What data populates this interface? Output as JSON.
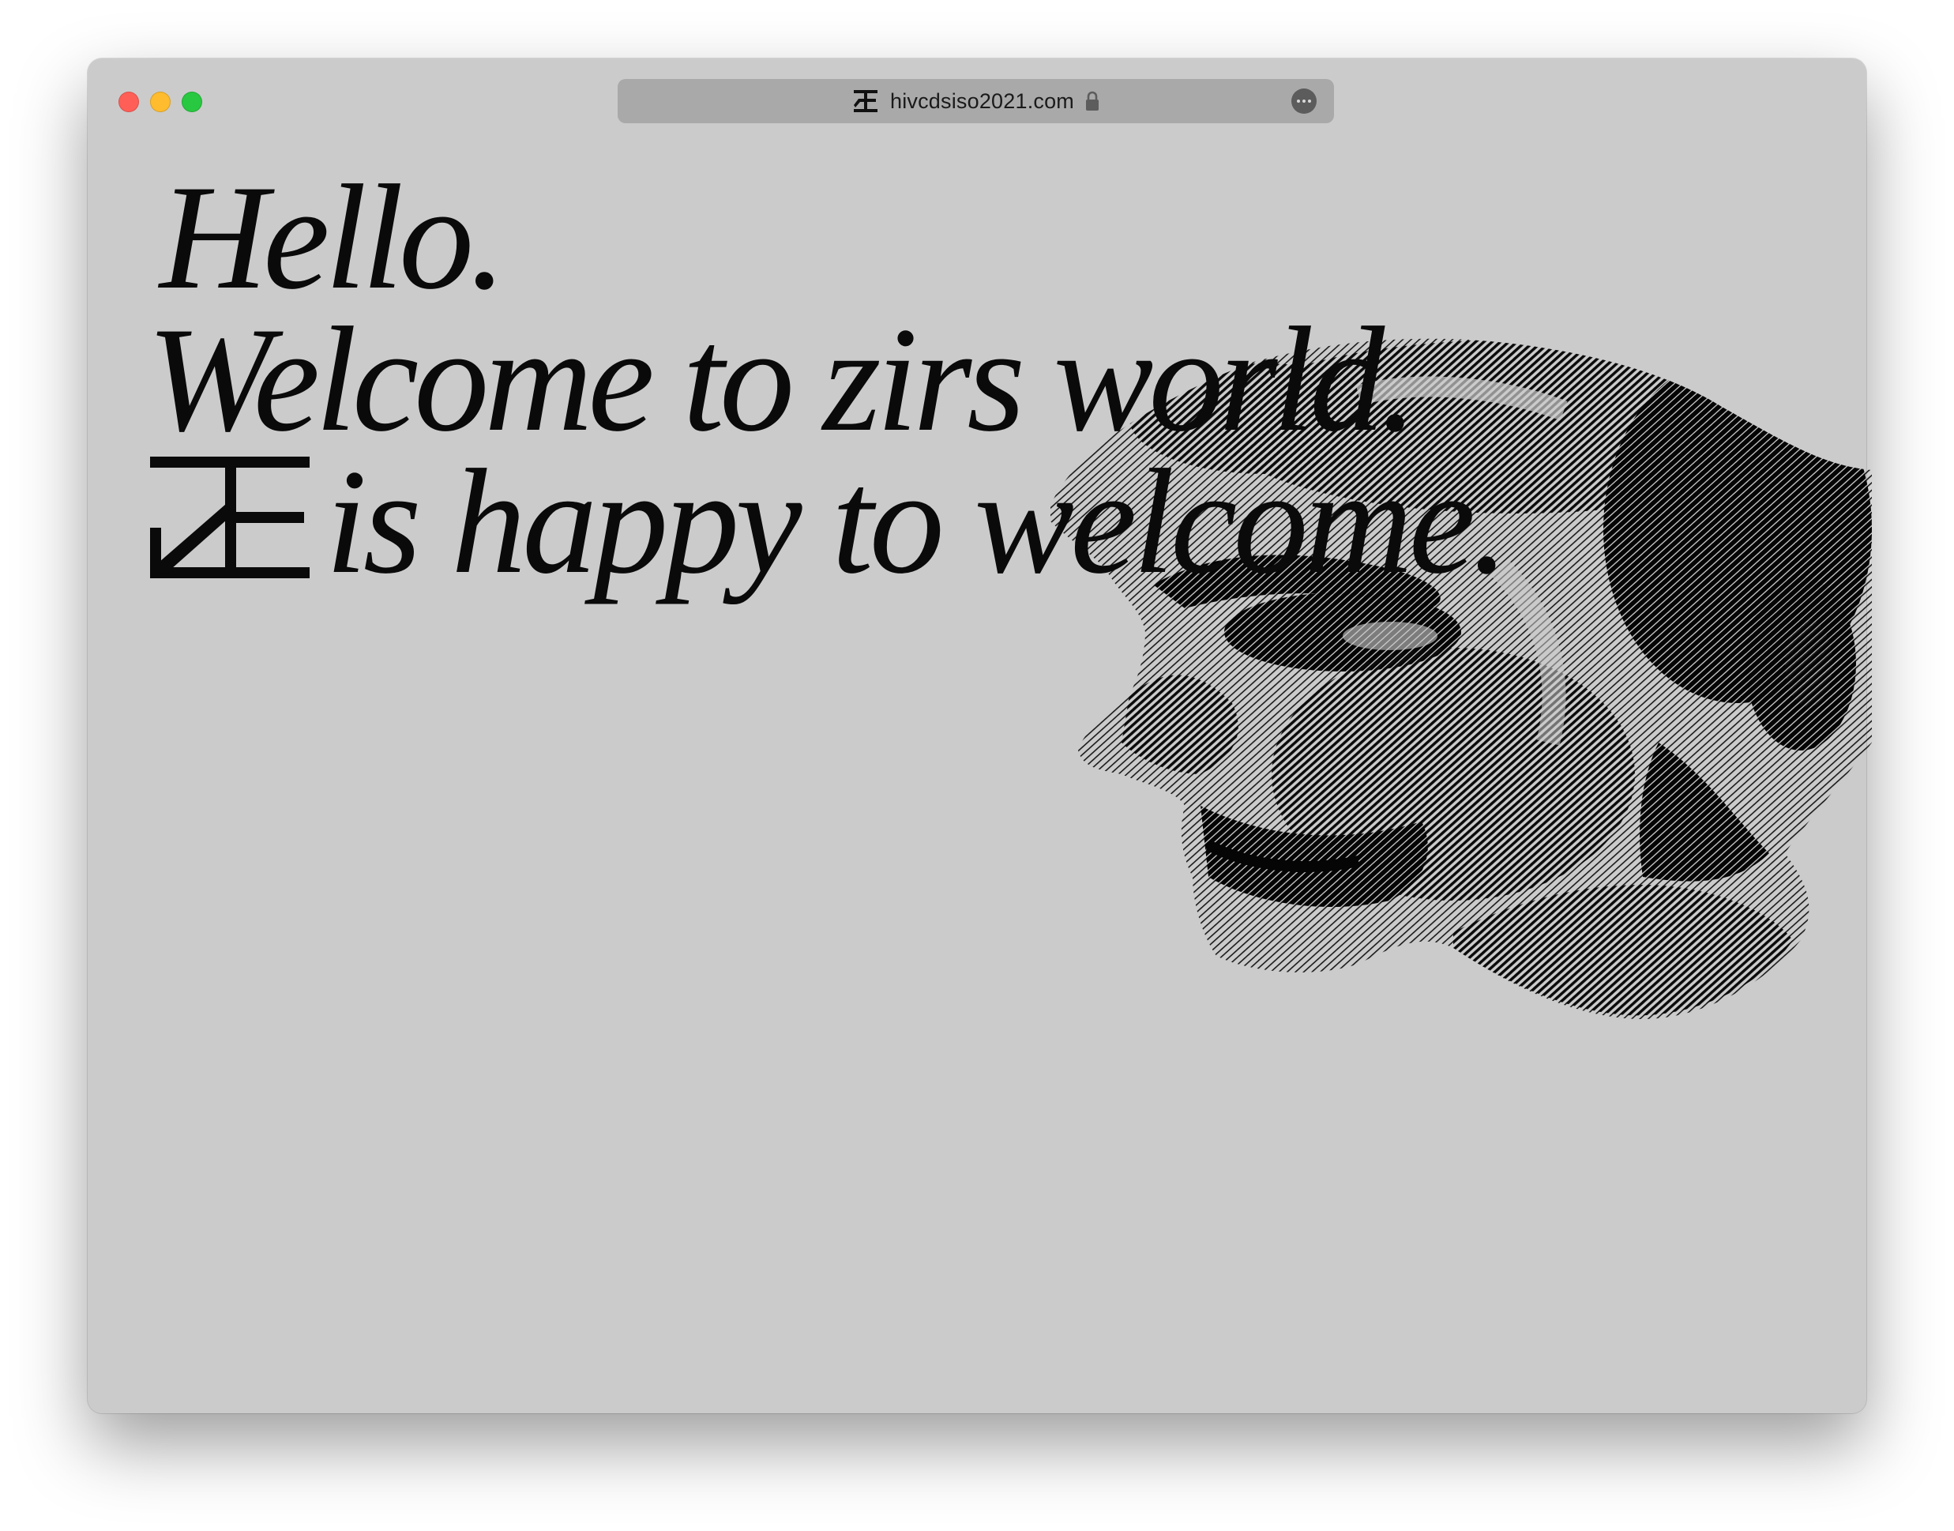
{
  "browser": {
    "url": "hivcdsiso2021.com",
    "favicon_icon": "ae-monogram-icon",
    "lock_icon": "lock-icon",
    "more_icon": "ellipsis-circle-icon"
  },
  "colors": {
    "page_background": "#cbcbcb",
    "text": "#0a0a0a",
    "url_bar": "#a9a9a9",
    "close": "#ff5f57",
    "minimize": "#febc2e",
    "maximize": "#28c840"
  },
  "hero": {
    "line1": "Hello.",
    "line2": "Welcome to zirs world.",
    "logo_icon": "ae-monogram-icon",
    "line3": "is happy to welcome."
  },
  "image": {
    "icon": "halftone-head-image"
  }
}
